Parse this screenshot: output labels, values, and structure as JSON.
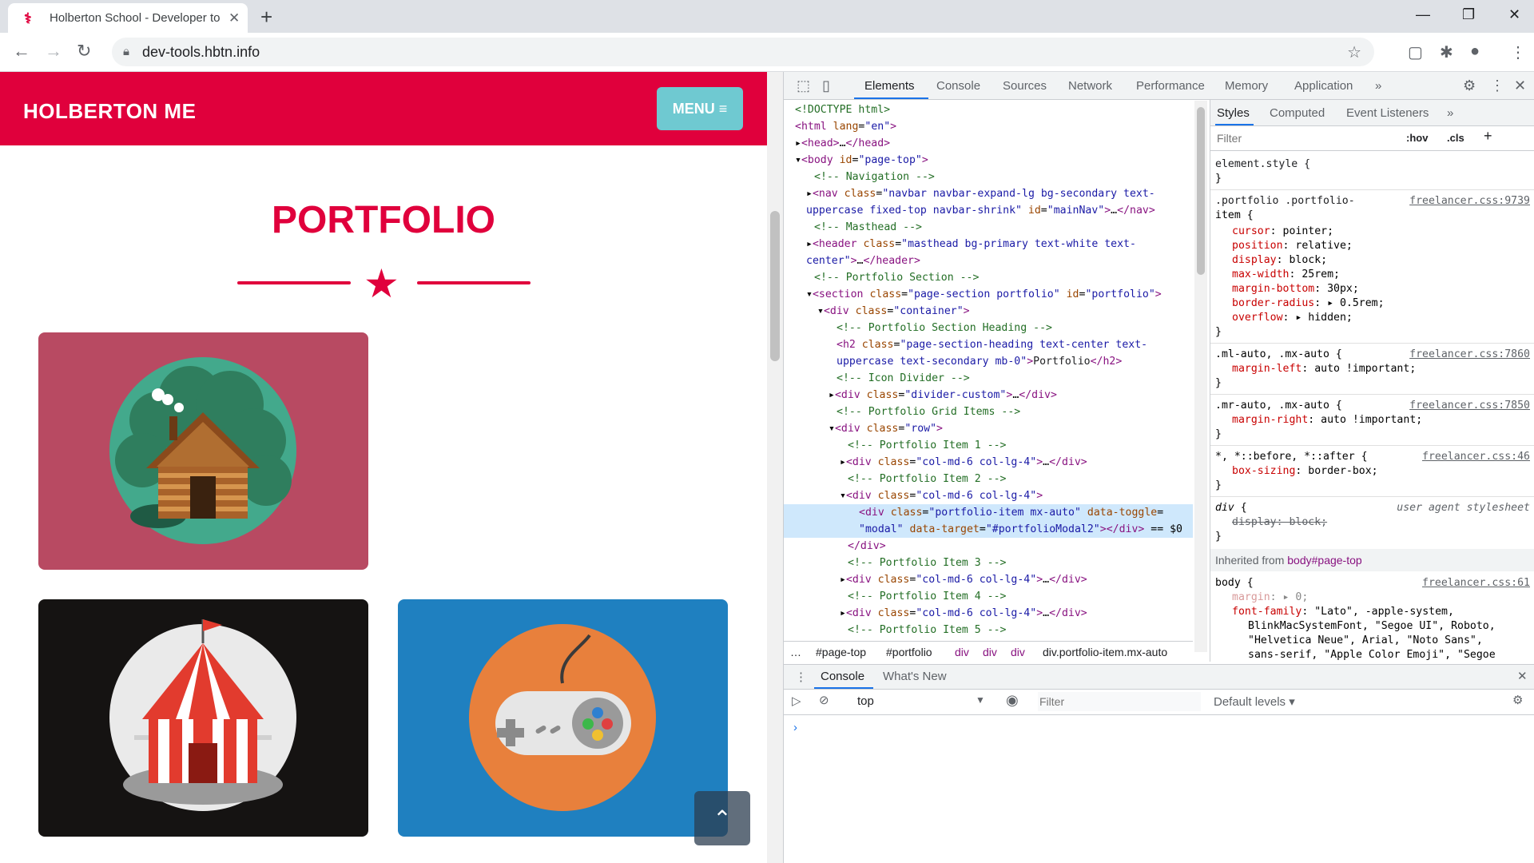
{
  "browser": {
    "tab_title": "Holberton School - Developer to",
    "url": "dev-tools.hbtn.info",
    "new_tab": "+",
    "close": "✕"
  },
  "site": {
    "brand": "HOLBERTON ME",
    "menu_label": "MENU ≡",
    "section_title": "PORTFOLIO",
    "scroll_top": "⌃"
  },
  "devtools": {
    "tabs": [
      "Elements",
      "Console",
      "Sources",
      "Network",
      "Performance",
      "Memory",
      "Application",
      "»"
    ],
    "dom_lines": [
      {
        "indent": 14,
        "html": "<span class='cm'>&lt;!DOCTYPE html&gt;</span>"
      },
      {
        "indent": 14,
        "html": "<span class='tg'>&lt;html</span> <span class='an'>lang</span>=<span class='av'>\"en\"</span><span class='tg'>&gt;</span>"
      },
      {
        "indent": 14,
        "html": "▸<span class='tg'>&lt;head&gt;</span>…<span class='tg'>&lt;/head&gt;</span>"
      },
      {
        "indent": 14,
        "html": "▾<span class='tg'>&lt;body</span> <span class='an'>id</span>=<span class='av'>\"page-top\"</span><span class='tg'>&gt;</span>"
      },
      {
        "indent": 38,
        "html": "<span class='cm'>&lt;!-- Navigation --&gt;</span>"
      },
      {
        "indent": 28,
        "html": "▸<span class='tg'>&lt;nav</span> <span class='an'>class</span>=<span class='av'>\"navbar navbar-expand-lg bg-secondary text-</span>"
      },
      {
        "indent": 28,
        "html": "<span class='av'>uppercase fixed-top navbar-shrink\"</span> <span class='an'>id</span>=<span class='av'>\"mainNav\"</span><span class='tg'>&gt;</span>…<span class='tg'>&lt;/nav&gt;</span>"
      },
      {
        "indent": 38,
        "html": "<span class='cm'>&lt;!-- Masthead --&gt;</span>"
      },
      {
        "indent": 28,
        "html": "▸<span class='tg'>&lt;header</span> <span class='an'>class</span>=<span class='av'>\"masthead bg-primary text-white text-</span>"
      },
      {
        "indent": 28,
        "html": "<span class='av'>center\"</span><span class='tg'>&gt;</span>…<span class='tg'>&lt;/header&gt;</span>"
      },
      {
        "indent": 38,
        "html": "<span class='cm'>&lt;!-- Portfolio Section --&gt;</span>"
      },
      {
        "indent": 28,
        "html": "▾<span class='tg'>&lt;section</span> <span class='an'>class</span>=<span class='av'>\"page-section portfolio\"</span> <span class='an'>id</span>=<span class='av'>\"portfolio\"</span><span class='tg'>&gt;</span>"
      },
      {
        "indent": 42,
        "html": "▾<span class='tg'>&lt;div</span> <span class='an'>class</span>=<span class='av'>\"container\"</span><span class='tg'>&gt;</span>"
      },
      {
        "indent": 66,
        "html": "<span class='cm'>&lt;!-- Portfolio Section Heading --&gt;</span>"
      },
      {
        "indent": 66,
        "html": "<span class='tg'>&lt;h2</span> <span class='an'>class</span>=<span class='av'>\"page-section-heading text-center text-</span>"
      },
      {
        "indent": 66,
        "html": "<span class='av'>uppercase text-secondary mb-0\"</span><span class='tg'>&gt;</span><span class='tx'>Portfolio</span><span class='tg'>&lt;/h2&gt;</span>"
      },
      {
        "indent": 66,
        "html": "<span class='cm'>&lt;!-- Icon Divider --&gt;</span>"
      },
      {
        "indent": 56,
        "html": "▸<span class='tg'>&lt;div</span> <span class='an'>class</span>=<span class='av'>\"divider-custom\"</span><span class='tg'>&gt;</span>…<span class='tg'>&lt;/div&gt;</span>"
      },
      {
        "indent": 66,
        "html": "<span class='cm'>&lt;!-- Portfolio Grid Items --&gt;</span>"
      },
      {
        "indent": 56,
        "html": "▾<span class='tg'>&lt;div</span> <span class='an'>class</span>=<span class='av'>\"row\"</span><span class='tg'>&gt;</span>"
      },
      {
        "indent": 80,
        "html": "<span class='cm'>&lt;!-- Portfolio Item 1 --&gt;</span>"
      },
      {
        "indent": 70,
        "html": "▸<span class='tg'>&lt;div</span> <span class='an'>class</span>=<span class='av'>\"col-md-6 col-lg-4\"</span><span class='tg'>&gt;</span>…<span class='tg'>&lt;/div&gt;</span>"
      },
      {
        "indent": 80,
        "html": "<span class='cm'>&lt;!-- Portfolio Item 2 --&gt;</span>"
      },
      {
        "indent": 70,
        "html": "▾<span class='tg'>&lt;div</span> <span class='an'>class</span>=<span class='av'>\"col-md-6 col-lg-4\"</span><span class='tg'>&gt;</span>"
      },
      {
        "indent": 94,
        "sel": true,
        "html": "<span class='tg'>&lt;div</span> <span class='an'>class</span>=<span class='av'>\"portfolio-item mx-auto\"</span> <span class='an'>data-toggle</span>="
      },
      {
        "indent": 94,
        "sel": true,
        "html": "<span class='av'>\"modal\"</span> <span class='an'>data-target</span>=<span class='av'>\"#portfolioModal2\"</span><span class='tg'>&gt;&lt;/div&gt;</span> == $0"
      },
      {
        "indent": 80,
        "html": "<span class='tg'>&lt;/div&gt;</span>"
      },
      {
        "indent": 80,
        "html": "<span class='cm'>&lt;!-- Portfolio Item 3 --&gt;</span>"
      },
      {
        "indent": 70,
        "html": "▸<span class='tg'>&lt;div</span> <span class='an'>class</span>=<span class='av'>\"col-md-6 col-lg-4\"</span><span class='tg'>&gt;</span>…<span class='tg'>&lt;/div&gt;</span>"
      },
      {
        "indent": 80,
        "html": "<span class='cm'>&lt;!-- Portfolio Item 4 --&gt;</span>"
      },
      {
        "indent": 70,
        "html": "▸<span class='tg'>&lt;div</span> <span class='an'>class</span>=<span class='av'>\"col-md-6 col-lg-4\"</span><span class='tg'>&gt;</span>…<span class='tg'>&lt;/div&gt;</span>"
      },
      {
        "indent": 80,
        "html": "<span class='cm'>&lt;!-- Portfolio Item 5 --&gt;</span>"
      }
    ],
    "breadcrumbs": [
      "…",
      "#page-top",
      "#portfolio",
      "div",
      "div",
      "div",
      "div.portfolio-item.mx-auto"
    ],
    "styles_tabs": [
      "Styles",
      "Computed",
      "Event Listeners",
      "»"
    ],
    "filter_placeholder": "Filter",
    "hov": ":hov",
    "cls": ".cls",
    "inherited_label": "Inherited from",
    "inherited_target": "body#page-top",
    "drawer_tabs": [
      "Console",
      "What's New"
    ],
    "context": "top",
    "console_filter": "Filter",
    "levels": "Default levels ▾"
  }
}
